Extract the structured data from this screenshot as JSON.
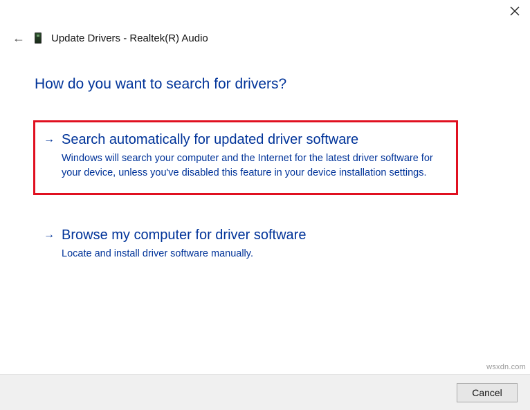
{
  "header": {
    "title": "Update Drivers - Realtek(R) Audio"
  },
  "question": "How do you want to search for drivers?",
  "options": [
    {
      "title": "Search automatically for updated driver software",
      "description": "Windows will search your computer and the Internet for the latest driver software for your device, unless you've disabled this feature in your device installation settings."
    },
    {
      "title": "Browse my computer for driver software",
      "description": "Locate and install driver software manually."
    }
  ],
  "footer": {
    "cancel_label": "Cancel"
  },
  "watermark": "wsxdn.com"
}
